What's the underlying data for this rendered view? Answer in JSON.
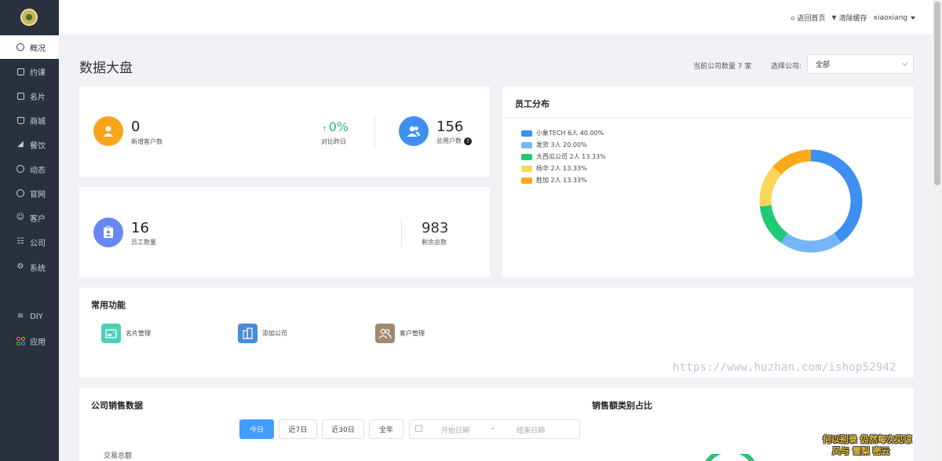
{
  "sidebar": {
    "items": [
      {
        "label": "概况",
        "icon": "pie-icon"
      },
      {
        "label": "约课",
        "icon": "calendar-icon"
      },
      {
        "label": "名片",
        "icon": "card-icon"
      },
      {
        "label": "商城",
        "icon": "bag-icon"
      },
      {
        "label": "餐饮",
        "icon": "dish-icon"
      },
      {
        "label": "动态",
        "icon": "compass-icon"
      },
      {
        "label": "官网",
        "icon": "globe-icon"
      },
      {
        "label": "客户",
        "icon": "user-icon"
      },
      {
        "label": "公司",
        "icon": "org-icon"
      },
      {
        "label": "系统",
        "icon": "gear-icon"
      }
    ],
    "extra": [
      {
        "label": "DIY",
        "icon": "diy-icon"
      },
      {
        "label": "应用",
        "icon": "apps-icon"
      }
    ]
  },
  "topbar": {
    "home": "返回首页",
    "clear_cache": "清除缓存",
    "username": "xiaoxiang"
  },
  "header": {
    "title": "数据大盘",
    "company_count": "当前公司数量 7 家",
    "select_label": "选择公司:",
    "select_value": "全部"
  },
  "stats": {
    "new_customers": {
      "value": "0",
      "label": "新增客户数"
    },
    "compare": {
      "value": "0%",
      "label": "对比昨日"
    },
    "total_users": {
      "value": "156",
      "label": "总用户数"
    },
    "staff": {
      "value": "16",
      "label": "员工数量"
    },
    "remaining": {
      "value": "983",
      "label": "剩余总数"
    }
  },
  "staff_distribution": {
    "title": "员工分布",
    "legend": [
      {
        "label": "小象TECH  6人  40.00%",
        "color": "#3d8ff0"
      },
      {
        "label": "发货  3人  20.00%",
        "color": "#74b6f7"
      },
      {
        "label": "大西瓜公司  2人  13.33%",
        "color": "#1ec978"
      },
      {
        "label": "杨华  2人  13.33%",
        "color": "#fcd65a"
      },
      {
        "label": "胜加  2人  13.33%",
        "color": "#fda818"
      }
    ]
  },
  "chart_data": {
    "type": "pie",
    "categories": [
      "小象TECH",
      "发货",
      "大西瓜公司",
      "杨华",
      "胜加"
    ],
    "values": [
      6,
      3,
      2,
      2,
      2
    ],
    "percent": [
      40.0,
      20.0,
      13.33,
      13.33,
      13.33
    ],
    "colors": [
      "#3d8ff0",
      "#74b6f7",
      "#1ec978",
      "#fcd65a",
      "#fda818"
    ],
    "title": "员工分布",
    "donut": true,
    "legend_position": "top-left"
  },
  "common_functions": {
    "title": "常用功能",
    "items": [
      {
        "label": "名片管理",
        "color": "#4fcfb8"
      },
      {
        "label": "添加公司",
        "color": "#4a8ad8"
      },
      {
        "label": "客户管理",
        "color": "#a08a6e"
      }
    ]
  },
  "sales": {
    "title": "公司销售数据",
    "buttons": [
      "今日",
      "近7日",
      "近30日",
      "全年"
    ],
    "start_placeholder": "开始日期",
    "end_placeholder": "结束日期",
    "range_sep": "-",
    "total_label": "交易总额"
  },
  "sales_ratio": {
    "title": "销售额类别占比"
  },
  "watermark": {
    "url": "https://www.huzhan.com/ishop52942",
    "line1": "何以别录 仍然每次见谅",
    "line2": "风与 雪梨 密云"
  }
}
